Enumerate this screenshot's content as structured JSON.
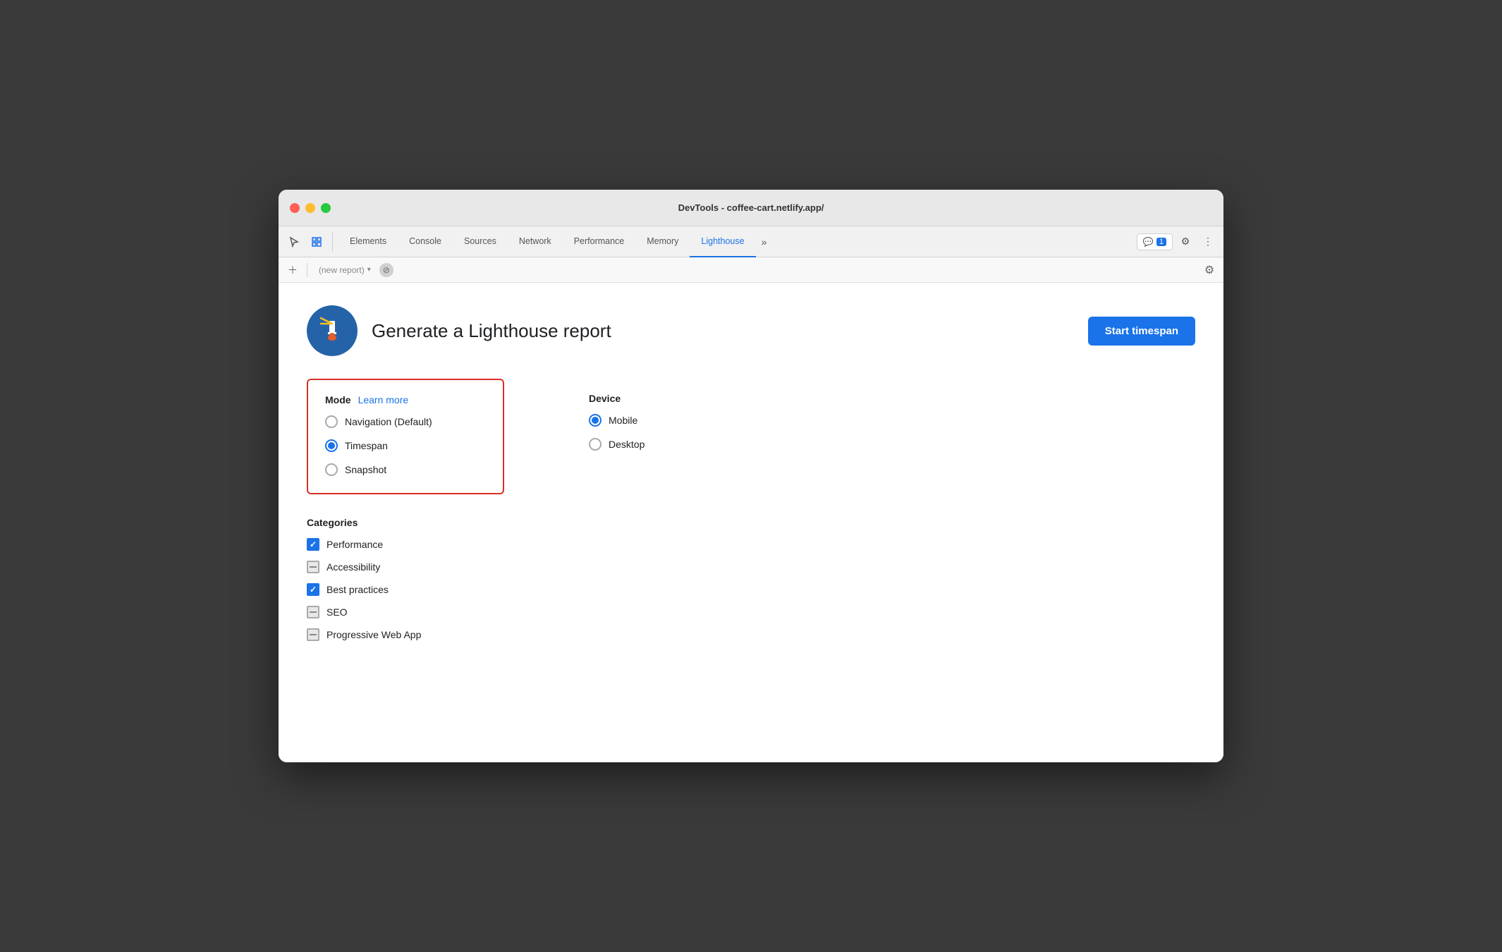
{
  "window": {
    "title": "DevTools - coffee-cart.netlify.app/"
  },
  "tabs": [
    {
      "id": "elements",
      "label": "Elements",
      "active": false
    },
    {
      "id": "console",
      "label": "Console",
      "active": false
    },
    {
      "id": "sources",
      "label": "Sources",
      "active": false
    },
    {
      "id": "network",
      "label": "Network",
      "active": false
    },
    {
      "id": "performance",
      "label": "Performance",
      "active": false
    },
    {
      "id": "memory",
      "label": "Memory",
      "active": false
    },
    {
      "id": "lighthouse",
      "label": "Lighthouse",
      "active": true
    }
  ],
  "toolbar": {
    "more_tabs_label": "»",
    "badge_count": "1",
    "new_report_placeholder": "(new report)"
  },
  "header": {
    "title": "Generate a Lighthouse report",
    "start_button_label": "Start timespan"
  },
  "mode": {
    "section_label": "Mode",
    "learn_more_label": "Learn more",
    "options": [
      {
        "id": "navigation",
        "label": "Navigation (Default)",
        "checked": false
      },
      {
        "id": "timespan",
        "label": "Timespan",
        "checked": true
      },
      {
        "id": "snapshot",
        "label": "Snapshot",
        "checked": false
      }
    ]
  },
  "device": {
    "section_label": "Device",
    "options": [
      {
        "id": "mobile",
        "label": "Mobile",
        "checked": true
      },
      {
        "id": "desktop",
        "label": "Desktop",
        "checked": false
      }
    ]
  },
  "categories": {
    "section_label": "Categories",
    "items": [
      {
        "id": "performance",
        "label": "Performance",
        "state": "checked"
      },
      {
        "id": "accessibility",
        "label": "Accessibility",
        "state": "indeterminate"
      },
      {
        "id": "best-practices",
        "label": "Best practices",
        "state": "checked"
      },
      {
        "id": "seo",
        "label": "SEO",
        "state": "indeterminate"
      },
      {
        "id": "pwa",
        "label": "Progressive Web App",
        "state": "indeterminate"
      }
    ]
  }
}
